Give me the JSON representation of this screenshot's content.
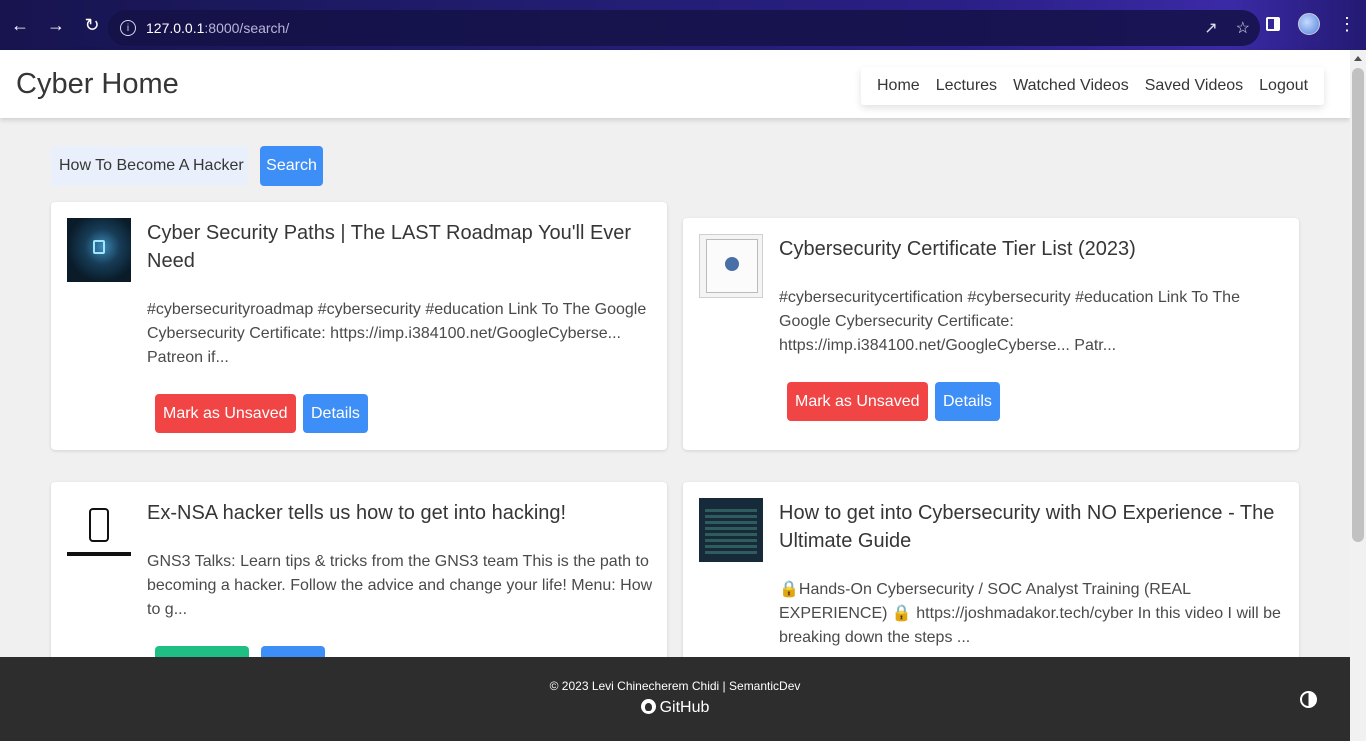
{
  "browser": {
    "url_host": "127.0.0.1",
    "url_path": ":8000/search/"
  },
  "navbar": {
    "brand": "Cyber Home",
    "links": [
      "Home",
      "Lectures",
      "Watched Videos",
      "Saved Videos",
      "Logout"
    ]
  },
  "search": {
    "value": "How To Become A Hacker",
    "button_label": "Search"
  },
  "cards": [
    {
      "title": "Cyber Security Paths | The LAST Roadmap You'll Ever Need",
      "description": "#cybersecurityroadmap #cybersecurity #education Link To The Google Cybersecurity Certificate: https://imp.i384100.net/GoogleCyberse... Patreon if...",
      "primary_button": "Mark as Unsaved",
      "details_button": "Details"
    },
    {
      "title": "Cybersecurity Certificate Tier List (2023)",
      "description": "#cybersecuritycertification #cybersecurity #education Link To The Google Cybersecurity Certificate: https://imp.i384100.net/GoogleCyberse... Patr...",
      "primary_button": "Mark as Unsaved",
      "details_button": "Details"
    },
    {
      "title": "Ex-NSA hacker tells us how to get into hacking!",
      "description": "GNS3 Talks: Learn tips & tricks from the GNS3 team This is the path to becoming a hacker. Follow the advice and change your life! Menu: How to g..."
    },
    {
      "title": "How to get into Cybersecurity with NO Experience - The Ultimate Guide",
      "description": "🔒Hands-On Cybersecurity / SOC Analyst Training (REAL EXPERIENCE) 🔒 https://joshmadakor.tech/cyber In this video I will be breaking down the steps ..."
    }
  ],
  "footer": {
    "copyright": "© 2023 Levi Chinecherem Chidi | SemanticDev",
    "github": "GitHub"
  },
  "colors": {
    "primary": "#3e8ef7",
    "danger": "#f14444",
    "success": "#1fbf84",
    "footer_bg": "#2d2d2d"
  }
}
